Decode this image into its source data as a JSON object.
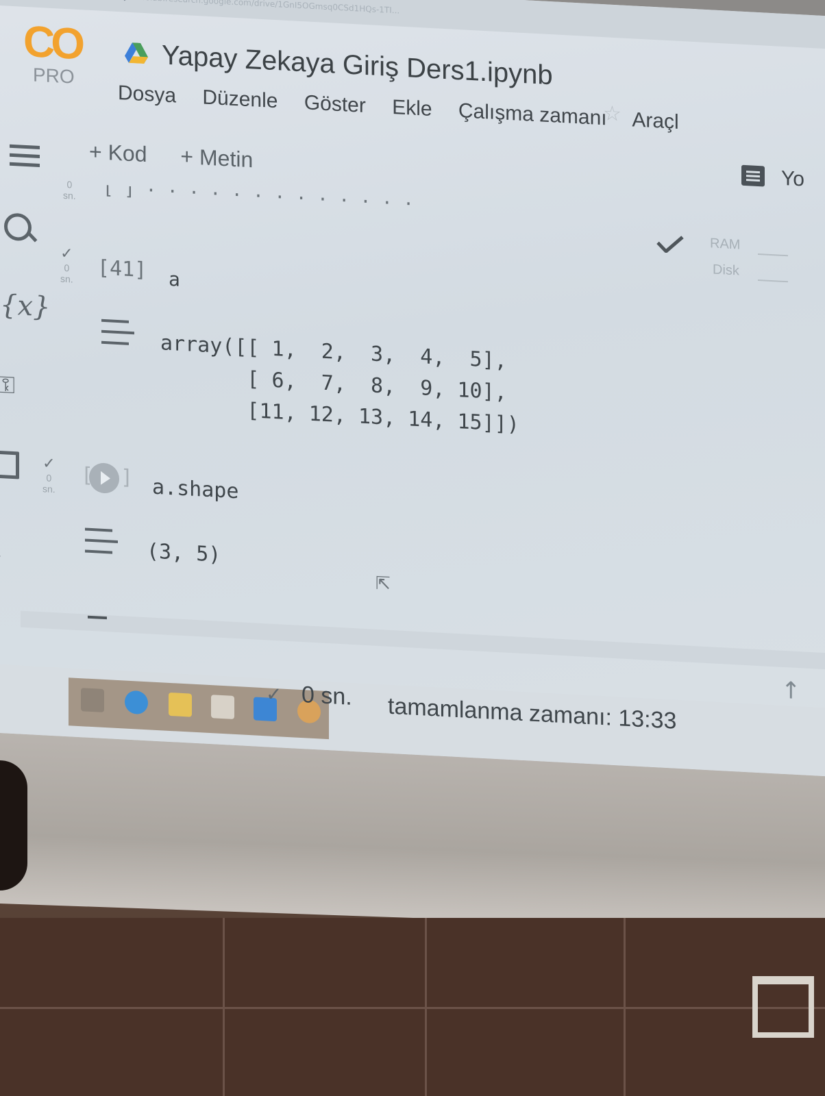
{
  "browser": {
    "url": "colab.research.google.com/drive/1GnI5OGmsq0CSd1HQs-1TI..."
  },
  "app": {
    "logo": "CO",
    "plan": "PRO",
    "notebook_title": "Yapay Zekaya Giriş Ders1.ipynb",
    "share_label": "Yo"
  },
  "menu": {
    "items": [
      "Dosya",
      "Düzenle",
      "Göster",
      "Ekle",
      "Çalışma zamanı",
      "Araçl"
    ]
  },
  "toolbar": {
    "add_code": "+ Kod",
    "add_text": "+ Metin"
  },
  "resources": {
    "ram": "RAM",
    "disk": "Disk"
  },
  "cells": [
    {
      "exec_count": "[41]",
      "source": "a",
      "time_num": "0",
      "time_unit": "sn.",
      "output": "array([[ 1,  2,  3,  4,  5],\n       [ 6,  7,  8,  9, 10],\n       [11, 12, 13, 14, 15]])"
    },
    {
      "exec_count": "[",
      "exec_count_close": "]",
      "source": "a.shape",
      "time_num": "0",
      "time_unit": "sn.",
      "output": "(3, 5)"
    }
  ],
  "partial_cell": {
    "time_num": "0",
    "time_unit": "sn."
  },
  "statusbar": {
    "elapsed": "0 sn.",
    "completed": "tamamlanma zamanı: 13:33"
  },
  "icons": {
    "sidebar": [
      "table-of-contents-icon",
      "search-icon",
      "variables-icon",
      "secrets-key-icon",
      "files-icon",
      "chevron-right-icon"
    ]
  }
}
